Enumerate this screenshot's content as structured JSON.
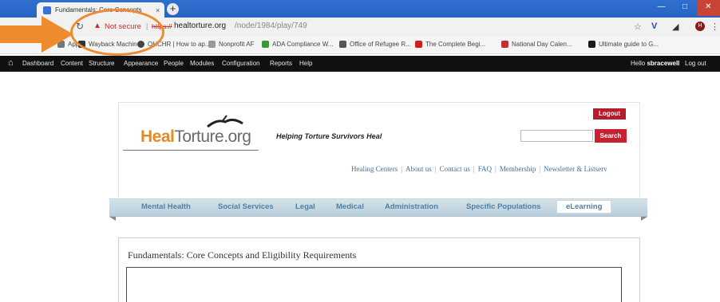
{
  "browser": {
    "tab_title": "Fundamentals: Core Concepts",
    "tab_close": "×",
    "new_tab": "+",
    "window_controls": [
      "—",
      "□",
      "✕"
    ],
    "reload_icon": "↻",
    "warning_icon": "▲",
    "not_secure": "Not secure",
    "sep": "|",
    "scheme": "https://",
    "host": "healtorture.org",
    "path": "/node/1984/play/749",
    "profile_initial": "H",
    "accent": "#2f6fd0"
  },
  "bookmarks": [
    {
      "label": "Apps",
      "color": "#777"
    },
    {
      "label": "Wayback Machine",
      "color": "#333"
    },
    {
      "label": "OHCHR | How to ap...",
      "color": "#444"
    },
    {
      "label": "Nonprofit AF",
      "color": "#999"
    },
    {
      "label": "ADA Compliance W...",
      "color": "#3a9a3a"
    },
    {
      "label": "Office of Refugee R...",
      "color": "#555"
    },
    {
      "label": "The Complete Begi...",
      "color": "#d02020"
    },
    {
      "label": "National Day Calen...",
      "color": "#c03030"
    },
    {
      "label": "Ultimate guide to G...",
      "color": "#1a1a1a"
    }
  ],
  "adminbar": {
    "home_icon": "⌂",
    "items": [
      "Dashboard",
      "Content",
      "Structure",
      "Appearance",
      "People",
      "Modules",
      "Configuration",
      "Reports",
      "Help"
    ],
    "hello": "Hello",
    "username": "sbracewell",
    "logout": "Log out"
  },
  "site": {
    "logo_heal": "Heal",
    "logo_rest": "Torture.org",
    "tagline": "Helping Torture Survivors Heal",
    "logout_button": "Logout",
    "search_button": "Search",
    "search_value": "",
    "top_links": [
      "Healing Centers",
      "About us",
      "Contact us",
      "FAQ",
      "Membership",
      "Newsletter & Listserv"
    ],
    "menu": [
      "Mental Health",
      "Social Services",
      "Legal",
      "Medical",
      "Administration",
      "Specific Populations",
      "eLearning"
    ],
    "page_title": "Fundamentals: Core Concepts and Eligibility Requirements",
    "brand_orange": "#e8891f",
    "brand_red": "#c8202f"
  },
  "annotation": {
    "color": "#ee8b2e"
  }
}
